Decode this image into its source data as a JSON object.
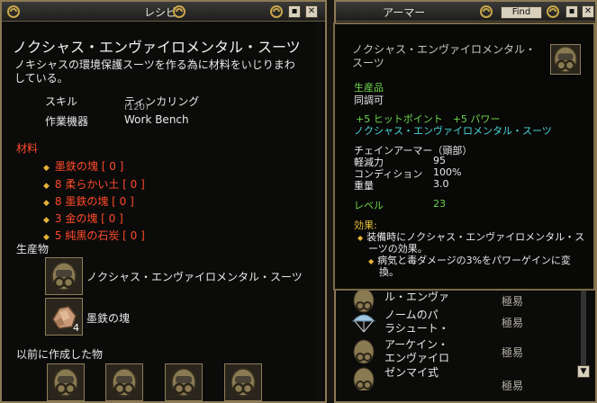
{
  "recipe_window": {
    "title": "レシピ",
    "item_title": "ノクシャス・エンヴァイロメンタル・スーツ",
    "description": "ノキシャスの環境保護スーツを作る為に材料をいじりまわしている。",
    "skill_label": "スキル",
    "skill_value": "ティンカリング",
    "skill_level": "(120)",
    "station_label": "作業機器",
    "station_value": "Work Bench",
    "materials_label": "材料",
    "materials": [
      "墨鉄の塊 [ 0 ]",
      "8 柔らかい土 [ 0 ]",
      "8 墨鉄の塊 [ 0 ]",
      "3 金の塊 [ 0 ]",
      "5 純黒の石炭 [ 0 ]"
    ],
    "products_label": "生産物",
    "products": [
      {
        "name": "ノクシャス・エンヴァイロメンタル・スーツ",
        "icon": "mask-helmet-icon",
        "qty": ""
      },
      {
        "name": "墨鉄の塊",
        "icon": "ore-icon",
        "qty": "4"
      }
    ],
    "previous_label": "以前に作成した物",
    "previous_count": 4
  },
  "armor_window": {
    "title": "アーマー",
    "find_label": "Find",
    "list": [
      {
        "name": "ル・エンヴァ",
        "difficulty": "極易",
        "icon": "mask-helmet-icon"
      },
      {
        "name": "ノームのパ\nラシュート・",
        "difficulty": "極易",
        "icon": "parachute-icon"
      },
      {
        "name": "アーケイン・\nエンヴァイロ",
        "difficulty": "極易",
        "icon": "mask-helmet-icon"
      },
      {
        "name": "ゼンマイ式",
        "difficulty": "極易",
        "icon": "mask-helmet-icon"
      }
    ]
  },
  "tooltip": {
    "name_line1": "ノクシャス・エンヴァイロメンタル・",
    "name_line2": "スーツ",
    "crafted": "生産品",
    "tradeable": "同調可",
    "bonus": "+5 ヒットポイント　+5 パワー",
    "set_name": "ノクシャス・エンヴァイロメンタル・スーツ",
    "slot_label": "チェインアーマー（頭部）",
    "stats": [
      {
        "label": "軽減力",
        "value": "95"
      },
      {
        "label": "コンディション",
        "value": "100%"
      },
      {
        "label": "重量",
        "value": "3.0"
      }
    ],
    "level_label": "レベル",
    "level_value": "23",
    "effect_label": "効果:",
    "effect_line1": "装備時にノクシャス・エンヴァイロメンタル・ス",
    "effect_line2": "ーツの効果。",
    "effect_sub1": "病気と毒ダメージの3%をパワーゲインに変",
    "effect_sub2": "換。"
  },
  "colors": {
    "frame": "#8c7a55",
    "material_red": "#ff4a2a",
    "tooltip_green": "#6ed64a",
    "tooltip_cyan": "#4ad6d6",
    "effect_yellow": "#e6c23a"
  }
}
